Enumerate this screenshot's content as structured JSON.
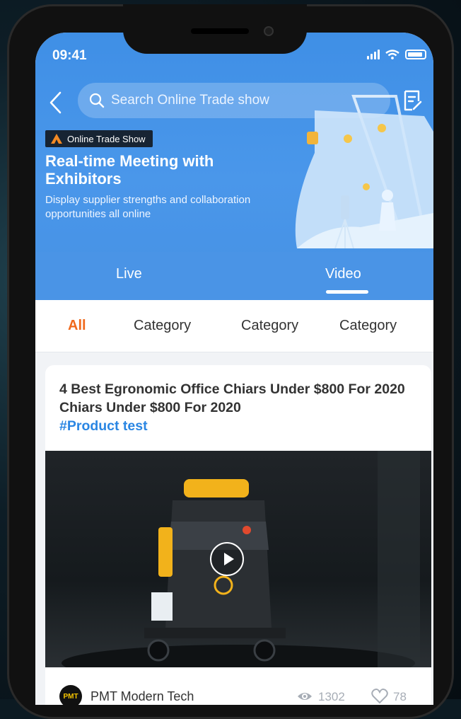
{
  "status": {
    "time": "09:41"
  },
  "header": {
    "search_placeholder": "Search Online Trade show",
    "badge": "Online Trade Show",
    "title": "Real-time Meeting with Exhibitors",
    "subtitle": "Display supplier strengths and collaboration opportunities all online"
  },
  "tabs": [
    {
      "label": "Live",
      "active": false
    },
    {
      "label": "Video",
      "active": true
    }
  ],
  "filters": [
    {
      "label": "All",
      "active": true
    },
    {
      "label": "Category",
      "active": false
    },
    {
      "label": "Category",
      "active": false
    },
    {
      "label": "Category",
      "active": false
    }
  ],
  "card": {
    "title": "4 Best Egronomic Office Chiars Under $800 For 2020 Chiars Under $800 For 2020",
    "hashtag": "#Product test",
    "company_logo_text": "PMT",
    "company": "PMT Modern Tech",
    "views": "1302",
    "likes": "78"
  },
  "colors": {
    "primary": "#4a94e6",
    "accent": "#f06a1d",
    "link": "#2a86e3"
  },
  "icons": [
    "back-arrow-icon",
    "search-icon",
    "note-icon",
    "signal-icon",
    "wifi-icon",
    "battery-icon",
    "play-icon",
    "eye-icon",
    "heart-icon"
  ]
}
